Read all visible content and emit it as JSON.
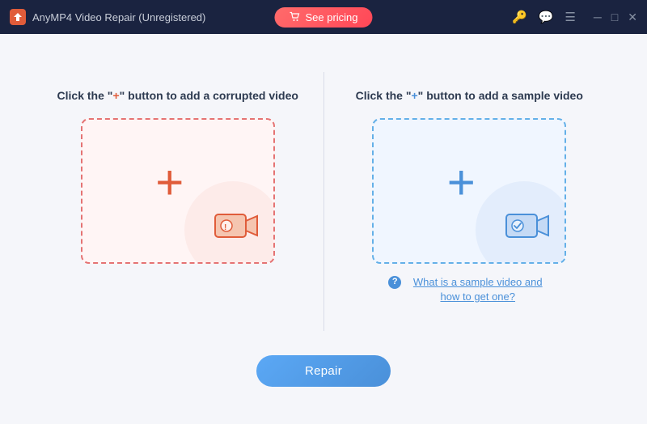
{
  "titlebar": {
    "app_icon": "V",
    "title": "AnyMP4 Video Repair (Unregistered)",
    "pricing_btn": "See pricing",
    "icons": [
      "key-icon",
      "chat-icon",
      "menu-icon"
    ],
    "window_controls": [
      "minimize",
      "maximize",
      "close"
    ]
  },
  "left_panel": {
    "label_before": "Click the \"",
    "label_plus": "+",
    "label_after": "\" button to add a corrupted video"
  },
  "right_panel": {
    "label_before": "Click the \"",
    "label_plus": "+",
    "label_after": "\" button to add a sample video",
    "help_link": "What is a sample video and how to get one?"
  },
  "repair_button": {
    "label": "Repair"
  }
}
